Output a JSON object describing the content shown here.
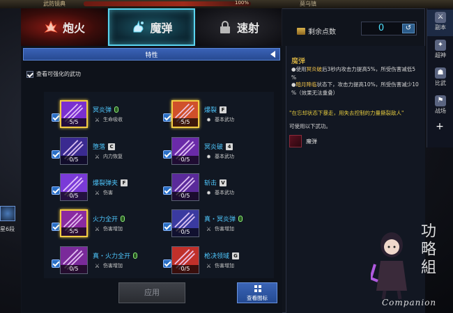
{
  "top_strip": {
    "left_title": "武防镜典",
    "percent": "100%",
    "location": "莫乌镇"
  },
  "tabs": [
    {
      "label": "炮火",
      "icon": "flame-hand-icon",
      "state": "normal"
    },
    {
      "label": "魔弹",
      "icon": "magic-hand-icon",
      "state": "selected"
    },
    {
      "label": "速射",
      "icon": "lock-icon",
      "state": "locked"
    }
  ],
  "points": {
    "label": "剩余点数",
    "value": "0"
  },
  "section": {
    "label": "特性"
  },
  "check_all": {
    "label": "查看可强化的武功",
    "checked": true
  },
  "skills": [
    {
      "name": "冥炎弹",
      "key": "mouse",
      "sub_label": "生命吸收",
      "count": "5/5",
      "gold": true,
      "color": "#7a2fd0"
    },
    {
      "name": "爆裂",
      "key": "F",
      "sub_label": "基本武功",
      "count": "5/5",
      "gold": true,
      "color": "#d0502a"
    },
    {
      "name": "堕落",
      "key": "C",
      "sub_label": "内力恢复",
      "count": "0/5",
      "gold": false,
      "color": "#3a2a90"
    },
    {
      "name": "冥炎破",
      "key": "4",
      "sub_label": "基本武功",
      "count": "0/5",
      "gold": false,
      "color": "#6a2aa8"
    },
    {
      "name": "爆裂弹夹",
      "key": "F",
      "sub_label": "伤害",
      "count": "0/5",
      "gold": false,
      "color": "#7a3ad8"
    },
    {
      "name": "斩击",
      "key": "V",
      "sub_label": "基本武功",
      "count": "0/5",
      "gold": false,
      "color": "#5a2a9a"
    },
    {
      "name": "火力全开",
      "key": "mouse",
      "sub_label": "伤害增加",
      "count": "5/5",
      "gold": true,
      "color": "#8a2aa0"
    },
    {
      "name": "真・冥炎弹",
      "key": "mouse",
      "sub_label": "伤害增加",
      "count": "0/5",
      "gold": false,
      "color": "#3a3aa0"
    },
    {
      "name": "真・火力全开",
      "key": "mouse",
      "sub_label": "伤害增加",
      "count": "0/5",
      "gold": false,
      "color": "#7a2a9a"
    },
    {
      "name": "枪决领域",
      "key": "G",
      "sub_label": "伤害增加",
      "count": "0/5",
      "gold": false,
      "color": "#c0302a"
    }
  ],
  "buttons": {
    "apply": "应用",
    "view_icons": "查看图标"
  },
  "description": {
    "title": "魔弹",
    "line1_prefix": "●使用",
    "line1_hl": "冥炎破",
    "line1_rest": "后3秒内攻击力提高5%，所受伤害减低5",
    "line1_cont": "%",
    "line2_prefix": "●",
    "line2_hl": "暗月降临",
    "line2_rest": "状态下，攻击力提高10%，所受伤害减少10",
    "line2_cont": "%（效果无法重叠）",
    "quote": "\"在忘却状态下暴走，用失去控制的力量撕裂敌人\"",
    "usable_label": "可使用以下武功。",
    "usable_item": "魔弹"
  },
  "sidebar": [
    {
      "label": "副本",
      "active": true
    },
    {
      "label": "超神",
      "active": false
    },
    {
      "label": "比武",
      "active": false
    },
    {
      "label": "战场",
      "active": false
    }
  ],
  "sidebar_plus": "+",
  "edge_hud": {
    "text": "星6段"
  },
  "watermark": {
    "cn": "功略組",
    "en": "Companion"
  }
}
